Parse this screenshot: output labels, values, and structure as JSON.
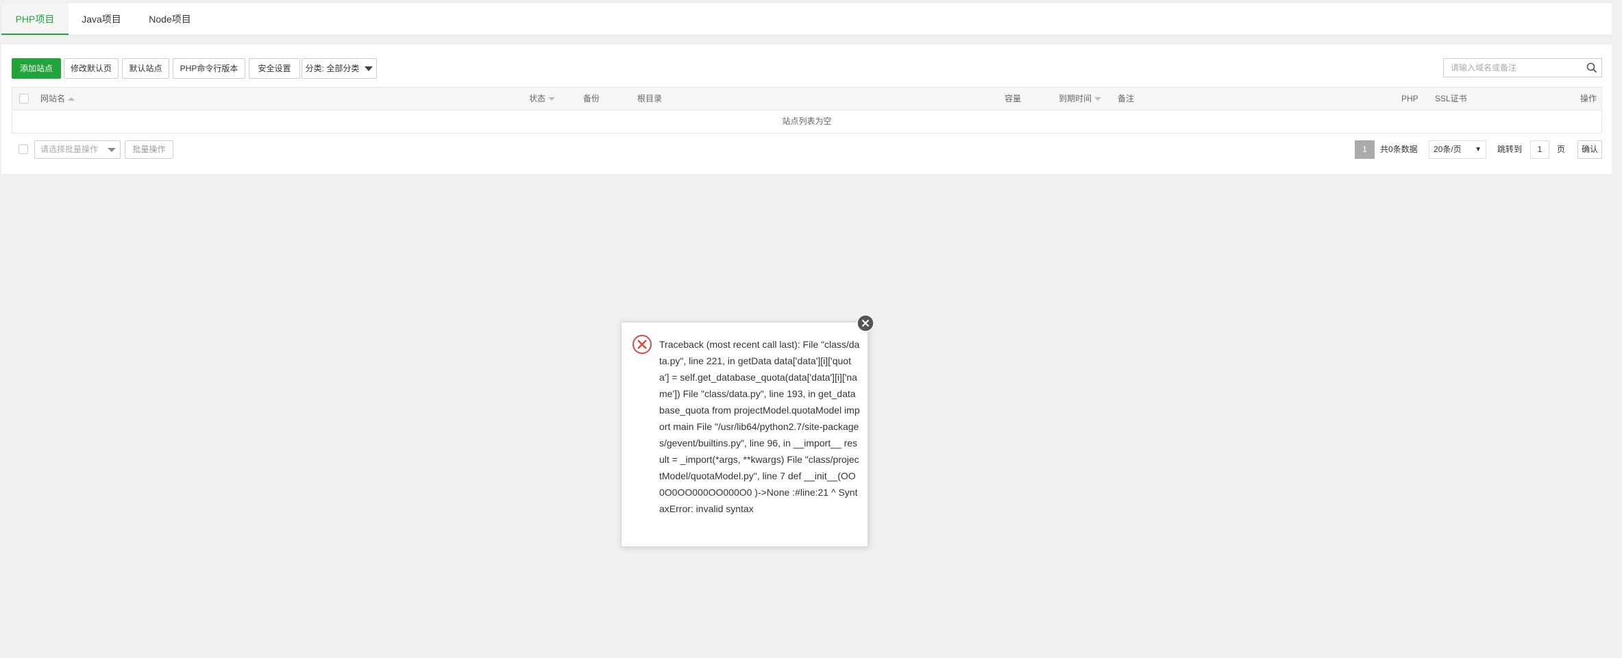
{
  "tabs": [
    {
      "label": "PHP项目",
      "active": true
    },
    {
      "label": "Java项目",
      "active": false
    },
    {
      "label": "Node项目",
      "active": false
    }
  ],
  "toolbar": {
    "add_site": "添加站点",
    "edit_default_page": "修改默认页",
    "default_site": "默认站点",
    "php_cli_version": "PHP命令行版本",
    "security_settings": "安全设置",
    "category": "分类: 全部分类"
  },
  "search": {
    "placeholder": "请输入域名或备注"
  },
  "table": {
    "columns": {
      "site_name": "网站名",
      "status": "状态",
      "backup": "备份",
      "root_dir": "根目录",
      "capacity": "容量",
      "expiry": "到期时间",
      "remark": "备注",
      "php": "PHP",
      "ssl": "SSL证书",
      "actions": "操作"
    },
    "empty_text": "站点列表为空"
  },
  "footer": {
    "batch_placeholder": "请选择批量操作",
    "batch_button": "批量操作",
    "current_page": "1",
    "total": "共0条数据",
    "per_page": "20条/页",
    "jump_label": "跳转到",
    "jump_value": "1",
    "jump_unit": "页",
    "confirm": "确认"
  },
  "dialog": {
    "message": "Traceback (most recent call last): File \"class/data.py\", line 221, in getData data['data'][i]['quota'] = self.get_database_quota(data['data'][i]['name']) File \"class/data.py\", line 193, in get_database_quota from projectModel.quotaModel import main File \"/usr/lib64/python2.7/site-packages/gevent/builtins.py\", line 96, in __import__ result = _import(*args, **kwargs) File \"class/projectModel/quotaModel.py\", line 7 def __init__(OO0O0OO000OO000O0 )->None :#line:21 ^ SyntaxError: invalid syntax"
  },
  "colors": {
    "accent": "#20a53a",
    "error": "#e0473d",
    "background": "#f0f0f0"
  }
}
